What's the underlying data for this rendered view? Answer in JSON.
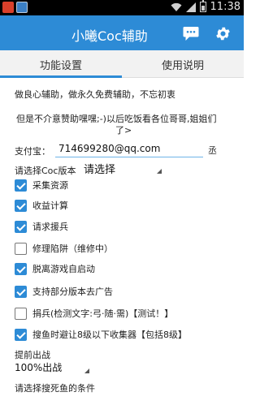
{
  "status_bar": {
    "time": "11:38",
    "icons": [
      "app-icon-red",
      "app-icon-blue",
      "wifi-icon",
      "signal-icon",
      "battery-icon"
    ]
  },
  "action_bar": {
    "title": "小曦Coc辅助",
    "color": "#2d8bd6",
    "buttons": [
      "chat-icon",
      "gear-icon"
    ]
  },
  "tabs": [
    {
      "label": "功能设置",
      "selected": true
    },
    {
      "label": "使用说明",
      "selected": false
    }
  ],
  "intro": {
    "line1": "做良心辅助，做永久免费辅助，不忘初衷",
    "line2": "但是不介意赞助嘿嘿;-)以后吃饭看各位哥哥,姐姐们",
    "line3": "了>"
  },
  "alipay": {
    "label": "支付宝：",
    "value": "714699280@qq.com",
    "copy_label": "丞"
  },
  "version": {
    "label": "请选择Coc版本",
    "selected": "请选择"
  },
  "options": [
    {
      "label": "采集资源",
      "checked": true
    },
    {
      "label": "收益计算",
      "checked": true
    },
    {
      "label": "请求援兵",
      "checked": true
    },
    {
      "label": "修理陷阱（维修中）",
      "checked": false
    },
    {
      "label": "脱离游戏自启动",
      "checked": true
    },
    {
      "label": "支持部分版本去广告",
      "checked": true
    },
    {
      "label": "捐兵(检测文字:弓·随·需)【测试！】",
      "checked": false
    },
    {
      "label": "搜鱼时避让8级以下收集器【包括8级】",
      "checked": true
    }
  ],
  "early_exit": {
    "label": "提前出战",
    "selected": "100%出战"
  },
  "condition_label": "请选择搜死鱼的条件"
}
